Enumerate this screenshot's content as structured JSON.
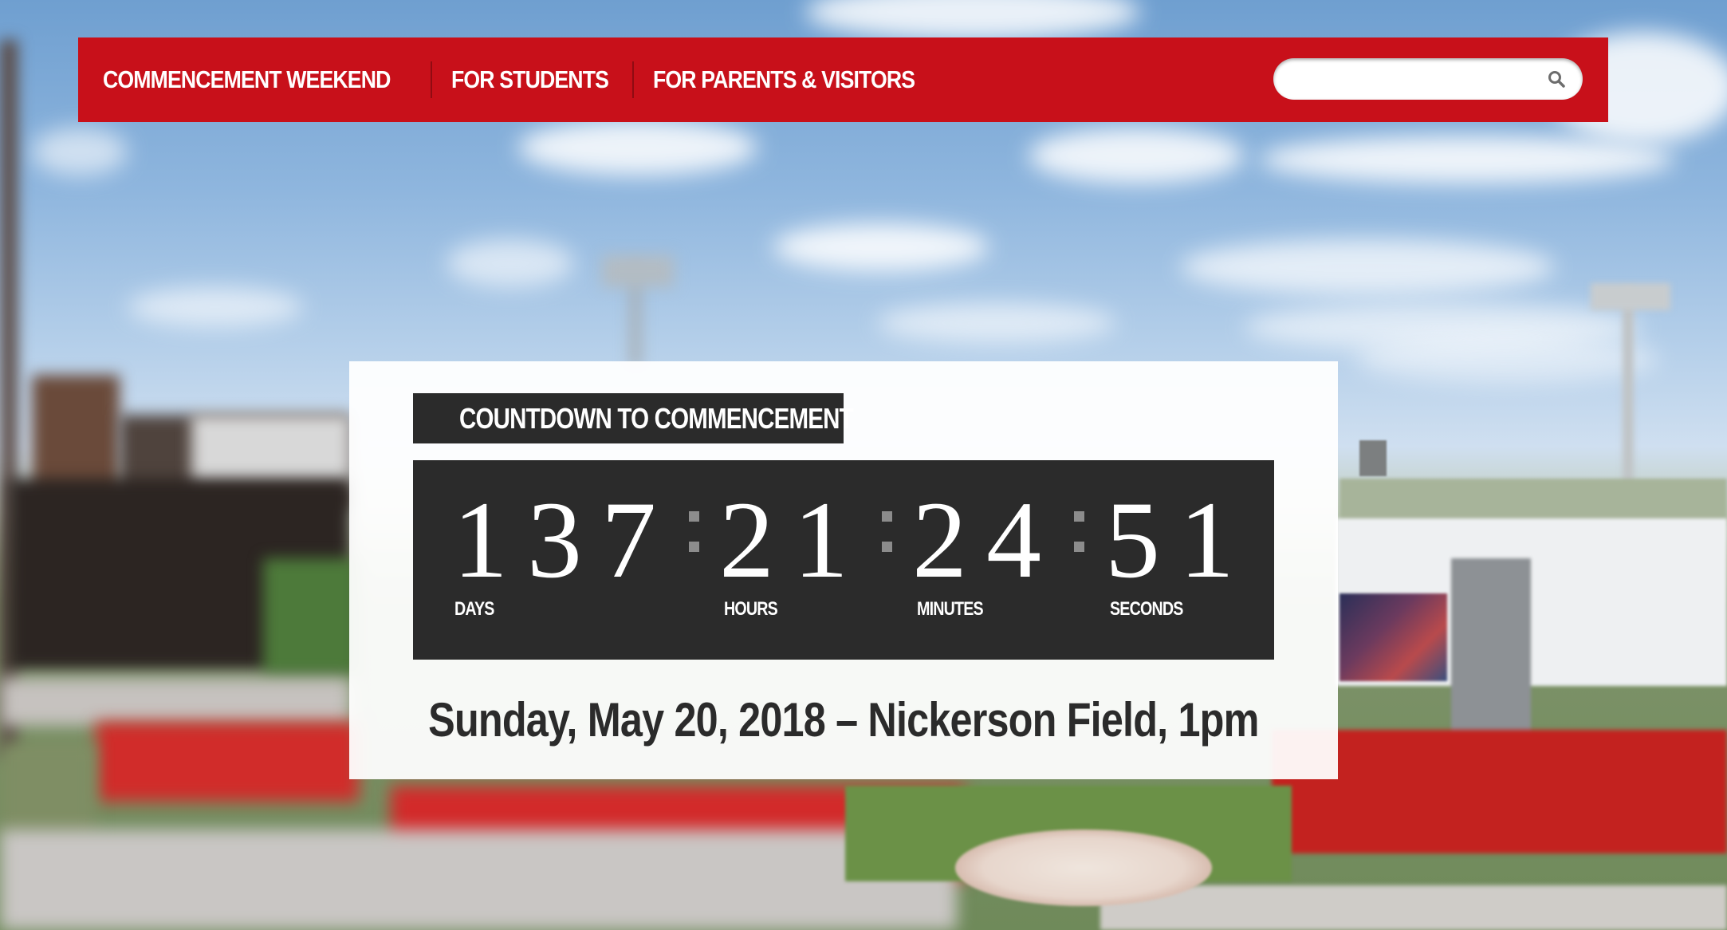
{
  "nav": {
    "items": [
      {
        "label": "COMMENCEMENT WEEKEND"
      },
      {
        "label": "FOR STUDENTS"
      },
      {
        "label": "FOR PARENTS & VISITORS"
      }
    ],
    "search": {
      "placeholder": ""
    },
    "colors": {
      "bar": "#c8101a",
      "text": "#ffffff"
    }
  },
  "countdown": {
    "label": "COUNTDOWN TO COMMENCEMENT",
    "days": "137",
    "hours": "21",
    "minutes": "24",
    "seconds": "51",
    "units": {
      "days": "DAYS",
      "hours": "HOURS",
      "minutes": "MINUTES",
      "seconds": "SECONDS"
    },
    "colors": {
      "box": "#2b2b2b",
      "digits": "#ffffff",
      "separator": "#8c8c8c"
    }
  },
  "event": {
    "line": "Sunday, May 20, 2018 – Nickerson Field, 1pm"
  },
  "icons": {
    "search": "search-icon"
  }
}
